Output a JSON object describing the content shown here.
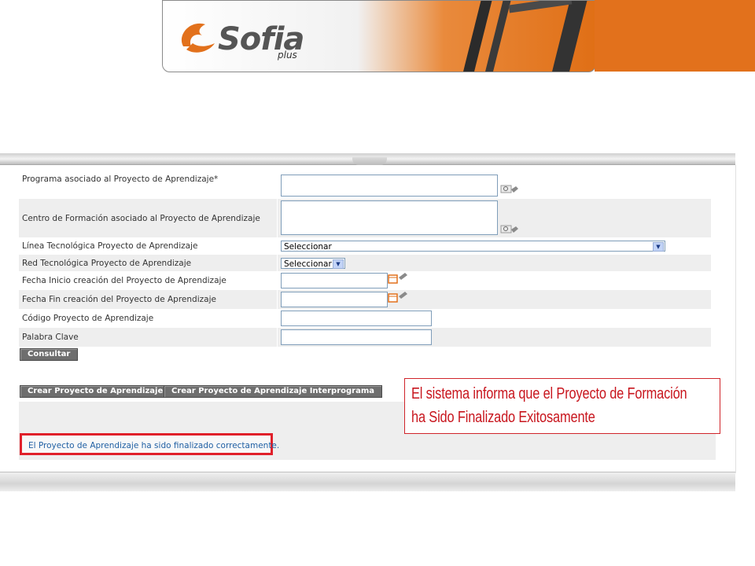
{
  "header": {
    "logo_text": "Sofia",
    "logo_subtext": "plus",
    "accent_color": "#e2711c"
  },
  "form": {
    "rows": [
      {
        "label": "Programa asociado al Proyecto de Aprendizaje*"
      },
      {
        "label": "Centro de Formación asociado al Proyecto de Aprendizaje"
      },
      {
        "label": "Línea Tecnológica Proyecto de Aprendizaje",
        "value": "Seleccionar"
      },
      {
        "label": "Red Tecnológica Proyecto de Aprendizaje",
        "value": "Seleccionar"
      },
      {
        "label": "Fecha Inicio creación del Proyecto de Aprendizaje",
        "value": ""
      },
      {
        "label": "Fecha Fin creación del Proyecto de Aprendizaje",
        "value": ""
      },
      {
        "label": "Código Proyecto de Aprendizaje",
        "value": ""
      },
      {
        "label": "Palabra Clave",
        "value": ""
      }
    ]
  },
  "buttons": {
    "consultar": "Consultar",
    "crear": "Crear Proyecto de Aprendizaje",
    "crear_interprograma": "Crear Proyecto de Aprendizaje Interprograma"
  },
  "message": {
    "text": "El Proyecto de Aprendizaje ha sido finalizado correctamente.",
    "highlight_color": "#e0202a"
  },
  "callout": {
    "line1": "El sistema informa que el Proyecto de Formación",
    "line2": "ha Sido Finalizado Exitosamente",
    "color": "#c8161e"
  }
}
